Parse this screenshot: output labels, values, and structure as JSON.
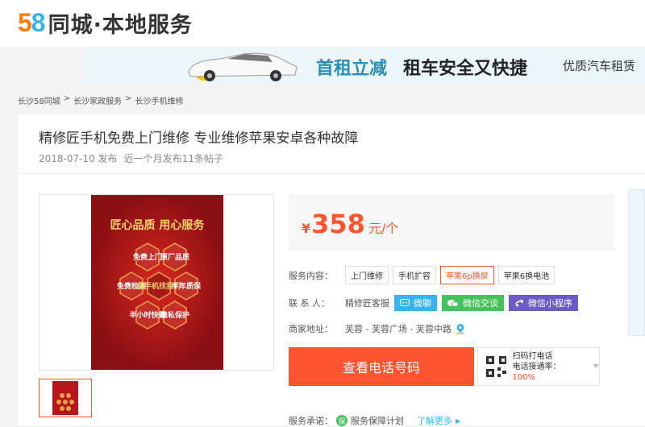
{
  "header": {
    "logo_num": [
      "5",
      "8"
    ],
    "logo_text": "同城·本地服务"
  },
  "banner": {
    "title_left": "首租立减",
    "title_right": "租车安全又快捷",
    "subtitle": "优质汽车租赁"
  },
  "breadcrumb": [
    "长沙58同城",
    ">",
    "长沙家政服务",
    ">",
    "长沙手机维修"
  ],
  "listing": {
    "title": "精修匠手机免费上门维修 专业维修苹果安卓各种故障",
    "date": "2018-07-10 发布",
    "posts": "近一个月发布11条帖子",
    "poster": {
      "headline": "匠心品质 用心服务",
      "hex": [
        "免费上门",
        "原厂品质",
        "免费检测",
        "修手机找我们",
        "半年质保",
        "半小时快修",
        "隐私保护"
      ]
    }
  },
  "price": {
    "currency": "¥",
    "value": "358",
    "unit": "元/个"
  },
  "service": {
    "label": "服务内容：",
    "tags": [
      "上门维修",
      "手机扩容",
      "苹果6p换屏",
      "苹果6换电池"
    ]
  },
  "contact": {
    "label": "联 系 人：",
    "name": "精修匠客服",
    "weiliao": "微聊",
    "wechat": "微信交谈",
    "miniprogram": "微信小程序"
  },
  "address": {
    "label": "商家地址：",
    "value": "芙蓉 - 芙蓉广场 - 芙蓉中路"
  },
  "actions": {
    "call": "查看电话号码",
    "scan": "扫码打电话",
    "rate_label": "电话接通率：",
    "rate": "100%"
  },
  "promise": {
    "label": "服务承诺：",
    "badge": "保",
    "plan": "服务保障计划",
    "more": "了解更多"
  },
  "colors": {
    "accent": "#ff552e",
    "wechat": "#45c35b",
    "weiliao": "#37b4f0",
    "mini": "#6c5bc7"
  }
}
